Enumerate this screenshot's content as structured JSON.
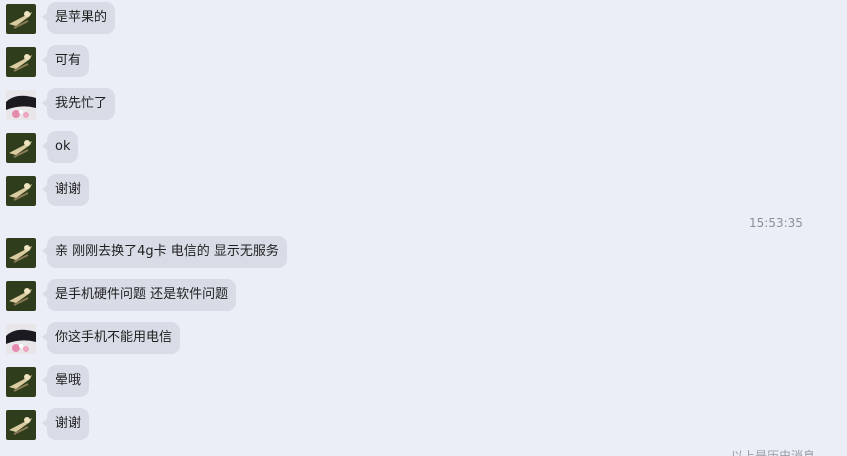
{
  "chat": {
    "messages": [
      {
        "avatar": "bird-avatar",
        "text": "是苹果的"
      },
      {
        "avatar": "bird-avatar",
        "text": "可有"
      },
      {
        "avatar": "user-avatar",
        "text": "我先忙了"
      },
      {
        "avatar": "bird-avatar",
        "text": "ok"
      },
      {
        "avatar": "bird-avatar",
        "text": "谢谢"
      },
      {
        "avatar": "bird-avatar",
        "text": "亲  刚刚去换了4g卡 电信的 显示无服务"
      },
      {
        "avatar": "bird-avatar",
        "text": "是手机硬件问题 还是软件问题"
      },
      {
        "avatar": "user-avatar",
        "text": "你这手机不能用电信"
      },
      {
        "avatar": "bird-avatar",
        "text": "晕哦"
      },
      {
        "avatar": "bird-avatar",
        "text": "谢谢"
      }
    ],
    "timestamp": "15:53:35",
    "history_notice": "以上是历史消息"
  },
  "colors": {
    "background": "#ebedf7",
    "bubble": "#d7dce6",
    "timestamp": "#8c8f9a"
  }
}
